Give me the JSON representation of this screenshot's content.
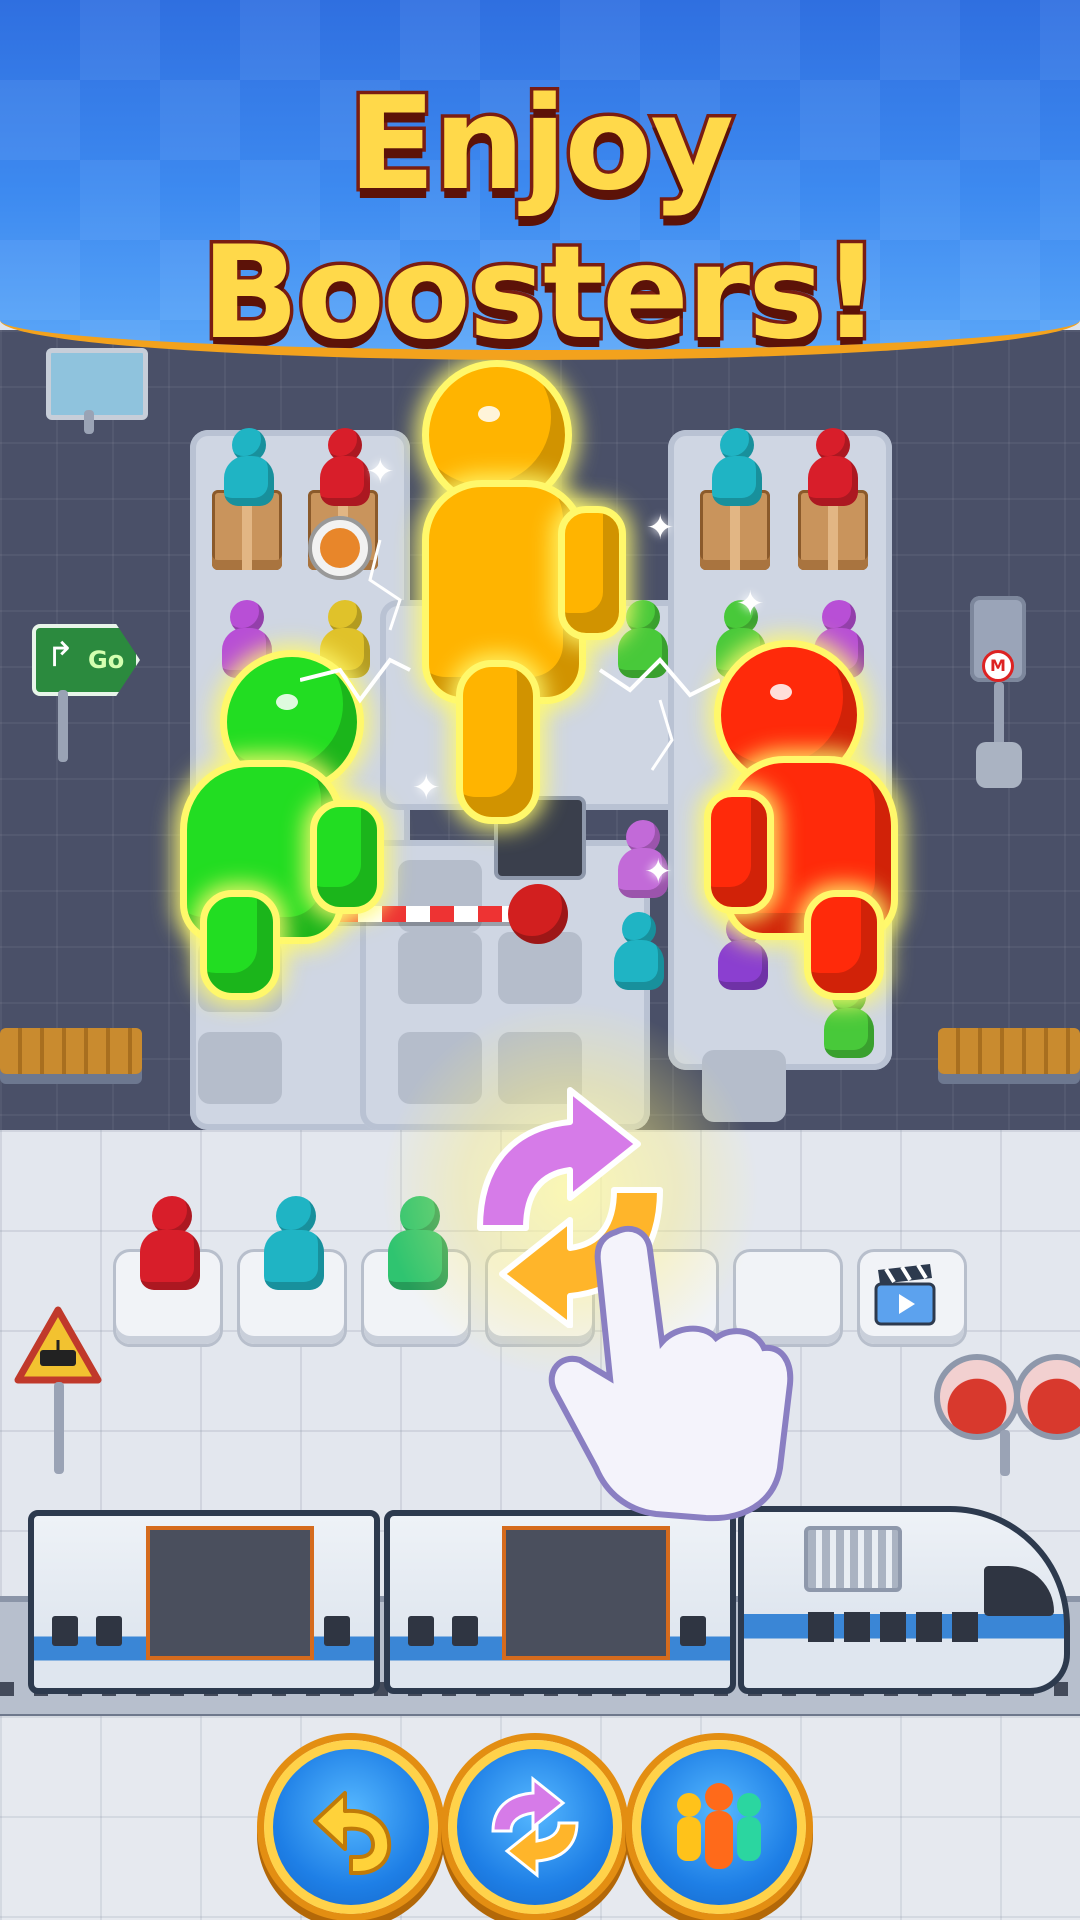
{
  "banner": {
    "title": "Enjoy Boosters!"
  },
  "signs": {
    "go_label": "Go",
    "metro_label": "M"
  },
  "colors": {
    "yellow": "#ffb400",
    "green": "#22dd22",
    "red": "#ff2a0a",
    "cyan": "#1fb4c4",
    "crimson": "#d81e2a",
    "purple": "#8b3fd0",
    "lime": "#48c93a",
    "violet": "#b84fd6",
    "mustard": "#e0c22a",
    "banner_blue": "#2f6fe0",
    "button_gold": "#ffd24a"
  },
  "queue": {
    "slots": 7,
    "occupants": [
      "red",
      "cyan",
      "green"
    ],
    "ad_slot_icon": "clapperboard-video-icon"
  },
  "boosters": [
    {
      "name": "undo",
      "icon": "undo-arrow-icon"
    },
    {
      "name": "shuffle",
      "icon": "swap-arrows-icon"
    },
    {
      "name": "crowd",
      "icon": "people-group-icon"
    }
  ]
}
